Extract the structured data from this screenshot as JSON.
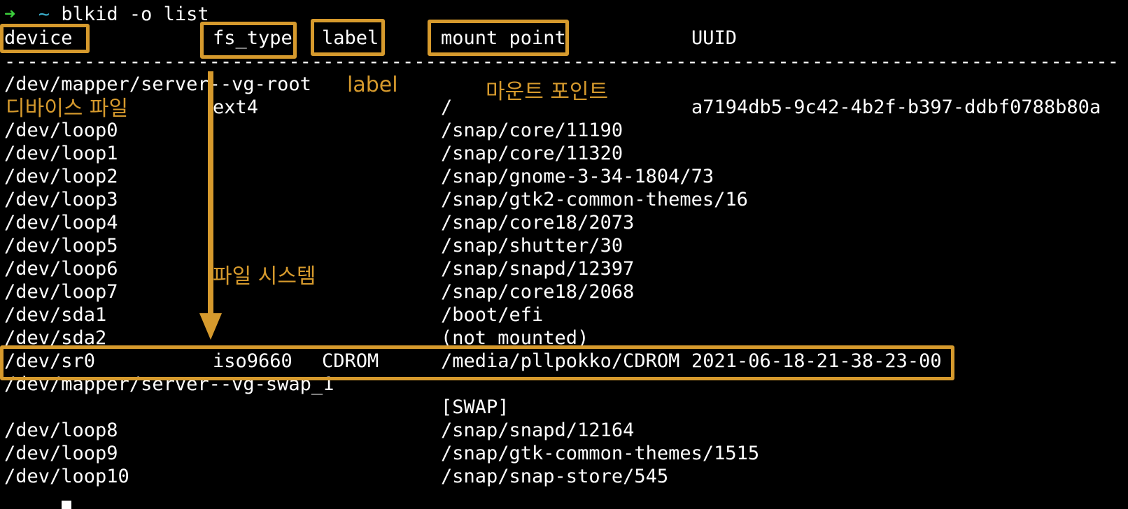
{
  "prompt": {
    "arrow": "➜",
    "tilde": "~",
    "command": "blkid -o list"
  },
  "headers": {
    "device": "device",
    "fs_type": "fs_type",
    "label": "label",
    "mount_point": "mount point",
    "uuid": "UUID"
  },
  "separator": "--------------------------------------------------------------------------------------------------",
  "rows": [
    {
      "device": "/dev/mapper/server--vg-root",
      "fs_type": "",
      "label": "",
      "mount_point": "",
      "uuid": ""
    },
    {
      "device": "",
      "fs_type": "ext4",
      "label": "",
      "mount_point": "/",
      "uuid": "a7194db5-9c42-4b2f-b397-ddbf0788b80a"
    },
    {
      "device": "/dev/loop0",
      "fs_type": "",
      "label": "",
      "mount_point": "/snap/core/11190",
      "uuid": ""
    },
    {
      "device": "/dev/loop1",
      "fs_type": "",
      "label": "",
      "mount_point": "/snap/core/11320",
      "uuid": ""
    },
    {
      "device": "/dev/loop2",
      "fs_type": "",
      "label": "",
      "mount_point": "/snap/gnome-3-34-1804/73",
      "uuid": ""
    },
    {
      "device": "/dev/loop3",
      "fs_type": "",
      "label": "",
      "mount_point": "/snap/gtk2-common-themes/16",
      "uuid": ""
    },
    {
      "device": "/dev/loop4",
      "fs_type": "",
      "label": "",
      "mount_point": "/snap/core18/2073",
      "uuid": ""
    },
    {
      "device": "/dev/loop5",
      "fs_type": "",
      "label": "",
      "mount_point": "/snap/shutter/30",
      "uuid": ""
    },
    {
      "device": "/dev/loop6",
      "fs_type": "",
      "label": "",
      "mount_point": "/snap/snapd/12397",
      "uuid": ""
    },
    {
      "device": "/dev/loop7",
      "fs_type": "",
      "label": "",
      "mount_point": "/snap/core18/2068",
      "uuid": ""
    },
    {
      "device": "/dev/sda1",
      "fs_type": "",
      "label": "",
      "mount_point": "/boot/efi",
      "uuid": ""
    },
    {
      "device": "/dev/sda2",
      "fs_type": "",
      "label": "",
      "mount_point": "(not mounted)",
      "uuid": ""
    },
    {
      "device": "/dev/sr0",
      "fs_type": "iso9660",
      "label": "CDROM",
      "mount_point": "/media/pllpokko/CDROM",
      "uuid": "2021-06-18-21-38-23-00"
    },
    {
      "device": "/dev/mapper/server--vg-swap_1",
      "fs_type": "",
      "label": "",
      "mount_point": "",
      "uuid": ""
    },
    {
      "device": "",
      "fs_type": "",
      "label": "",
      "mount_point": "[SWAP]",
      "uuid": ""
    },
    {
      "device": "/dev/loop8",
      "fs_type": "",
      "label": "",
      "mount_point": "/snap/snapd/12164",
      "uuid": ""
    },
    {
      "device": "/dev/loop9",
      "fs_type": "",
      "label": "",
      "mount_point": "/snap/gtk-common-themes/1515",
      "uuid": ""
    },
    {
      "device": "/dev/loop10",
      "fs_type": "",
      "label": "",
      "mount_point": "/snap/snap-store/545",
      "uuid": ""
    }
  ],
  "annotations": {
    "label": "label",
    "mount_point": "마운트 포인트",
    "device_file": "디바이스 파일",
    "file_system": "파일 시스템"
  },
  "colors": {
    "background": "#000000",
    "text": "#ffffff",
    "annotation": "#d69a2d",
    "prompt_arrow": "#3ccf3c",
    "prompt_tilde": "#3aaecb"
  }
}
